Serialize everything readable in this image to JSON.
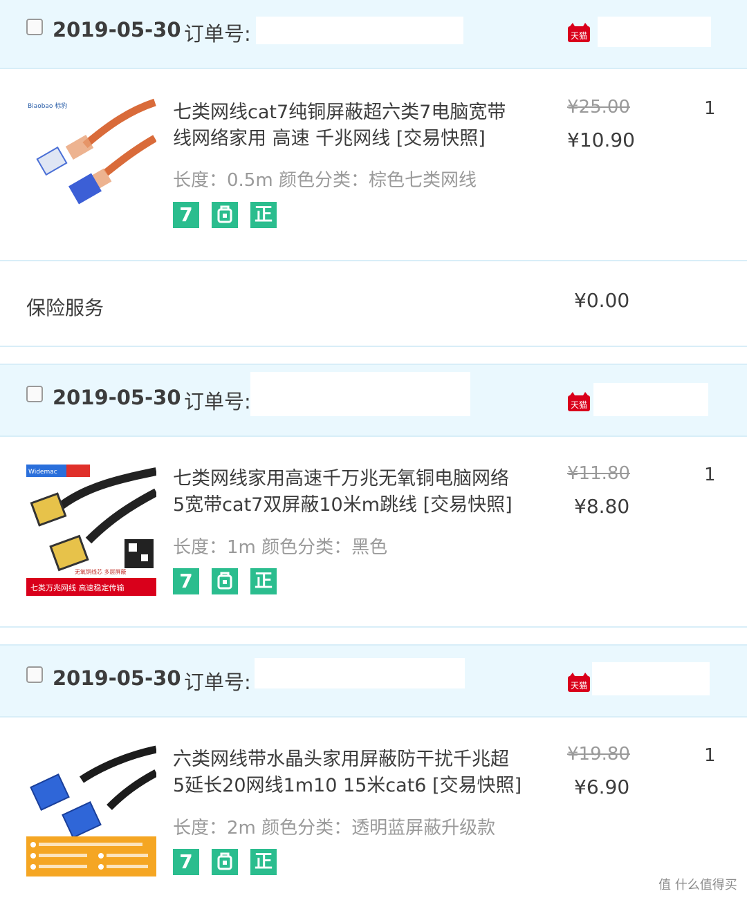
{
  "orders": [
    {
      "date": "2019-05-30",
      "order_no_label": "订单号:",
      "product": {
        "title_line1": "七类网线cat7纯铜屏蔽超六类7电脑宽带",
        "title_line2": "线网络家用 高速 千兆网线 [交易快照]",
        "specs": "长度：0.5m   颜色分类：棕色七类网线",
        "original_price": "¥25.00",
        "price": "¥10.90",
        "quantity": "1",
        "image_brand_text": "Biaobao 标豹"
      },
      "service": {
        "label": "保险服务",
        "price": "¥0.00"
      }
    },
    {
      "date": "2019-05-30",
      "order_no_label": "订单号:",
      "product": {
        "title_line1": "七类网线家用高速千万兆无氧铜电脑网络",
        "title_line2": "5宽带cat7双屏蔽10米m跳线 [交易快照]",
        "specs": "长度：1m   颜色分类：黑色",
        "original_price": "¥11.80",
        "price": "¥8.80",
        "quantity": "1",
        "image_brand_text": "Widemac",
        "image_caption": "无氧铜线芯 多层屏蔽",
        "image_banner": "七类万兆网线 高速稳定传输"
      }
    },
    {
      "date": "2019-05-30",
      "order_no_label": "订单号:",
      "product": {
        "title_line1": "六类网线带水晶头家用屏蔽防干扰千兆超",
        "title_line2": "5延长20网线1m10 15米cat6 [交易快照]",
        "specs": "长度：2m   颜色分类：透明蓝屏蔽升级款",
        "original_price": "¥19.80",
        "price": "¥6.90",
        "quantity": "1"
      }
    }
  ],
  "badges": {
    "seven_day": "7",
    "guarantee": "正"
  },
  "shop_badge": {
    "text": "天猫",
    "color": "#d9001b"
  },
  "accent_color": "#2bbd8e",
  "header_bg": "#eaf8fe",
  "watermark": "值 什么值得买"
}
